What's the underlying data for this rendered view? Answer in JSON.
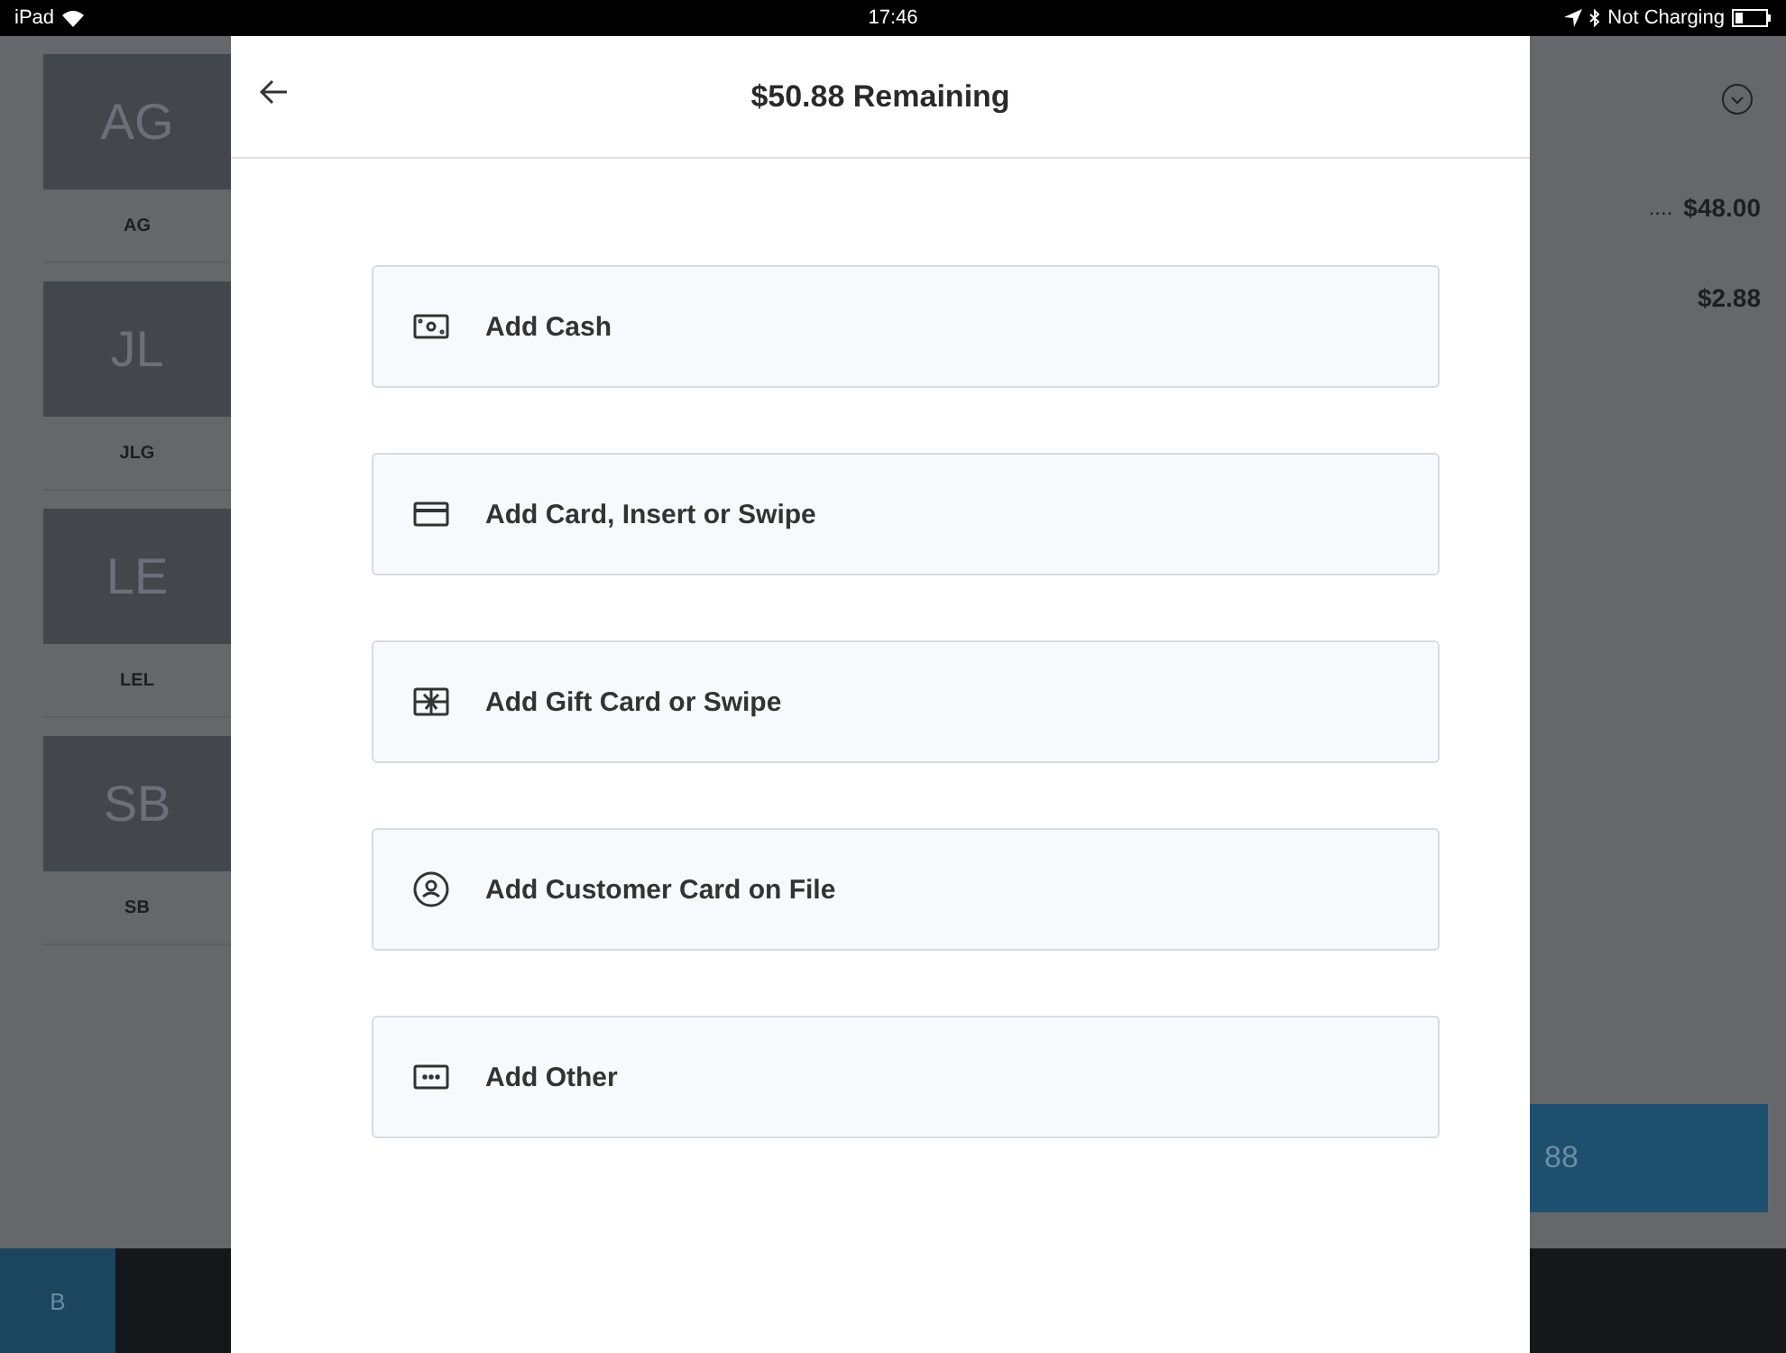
{
  "status_bar": {
    "carrier": "iPad",
    "time": "17:46",
    "battery_text": "Not Charging"
  },
  "background": {
    "tiles": [
      {
        "initials": "AG",
        "label": "AG"
      },
      {
        "initials": "JL",
        "label": "JLG"
      },
      {
        "initials": "LE",
        "label": "LEL"
      },
      {
        "initials": "SB",
        "label": "SB"
      }
    ],
    "bottom_tab": "B",
    "lines": [
      {
        "dots": "....",
        "amount": "$48.00"
      },
      {
        "amount": "$2.88"
      }
    ],
    "charge_button": "88"
  },
  "modal": {
    "title": "$50.88 Remaining",
    "options": [
      {
        "kind": "cash",
        "label": "Add Cash"
      },
      {
        "kind": "card",
        "label": "Add Card, Insert or Swipe"
      },
      {
        "kind": "gift",
        "label": "Add Gift Card or Swipe"
      },
      {
        "kind": "customer",
        "label": "Add Customer Card on File"
      },
      {
        "kind": "other",
        "label": "Add Other"
      }
    ]
  }
}
